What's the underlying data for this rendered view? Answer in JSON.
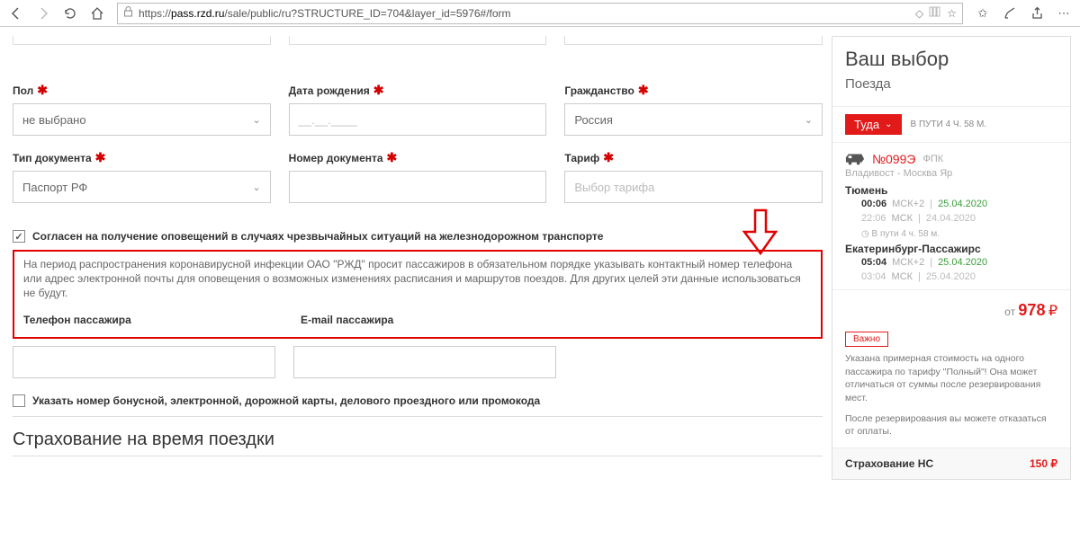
{
  "browser": {
    "url_prefix": "https://",
    "url_host": "pass.rzd.ru",
    "url_path": "/sale/public/ru?STRUCTURE_ID=704&layer_id=5976#/form"
  },
  "form": {
    "gender_label": "Пол",
    "gender_value": "не выбрано",
    "birthdate_label": "Дата рождения",
    "birthdate_placeholder": "__.__.____",
    "citizenship_label": "Гражданство",
    "citizenship_value": "Россия",
    "doctype_label": "Тип документа",
    "doctype_value": "Паспорт РФ",
    "docnum_label": "Номер документа",
    "tariff_label": "Тариф",
    "tariff_placeholder": "Выбор тарифа",
    "consent_text": "Согласен на получение оповещений в случаях чрезвычайных ситуаций на железнодорожном транспорте",
    "notice_text": "На период распространения коронавирусной инфекции ОАО \"РЖД\" просит пассажиров в обязательном порядке указывать контактный номер телефона или адрес электронной почты для оповещения о возможных изменениях расписания и маршрутов поездов. Для других целей эти данные использоваться не будут.",
    "phone_label": "Телефон пассажира",
    "email_label": "E-mail пассажира",
    "bonus_text": "Указать номер бонусной, электронной, дорожной карты, делового проездного или промокода",
    "insurance_title": "Страхование на время поездки"
  },
  "sidebar": {
    "title": "Ваш выбор",
    "subtitle": "Поезда",
    "direction": "Туда",
    "travel_label": "В ПУТИ 4 Ч. 58 М.",
    "train_number": "№099Э",
    "train_company": "ФПК",
    "route": "Владивост - Москва Яр",
    "dep_city": "Тюмень",
    "dep_time1": "00:06",
    "dep_tz1": "МСК+2",
    "dep_date1": "25.04.2020",
    "dep_time2": "22:06",
    "dep_tz2": "МСК",
    "dep_date2": "24.04.2020",
    "between": "В пути  4 ч.  58 м.",
    "arr_city": "Екатеринбург-Пассажирс",
    "arr_time1": "05:04",
    "arr_tz1": "МСК+2",
    "arr_date1": "25.04.2020",
    "arr_time2": "03:04",
    "arr_tz2": "МСК",
    "arr_date2": "25.04.2020",
    "from_label": "от",
    "price": "978",
    "currency": "₽",
    "important": "Важно",
    "important_text1": "Указана примерная стоимость на одного пассажира по тарифу \"Полный\"! Она может отличаться от суммы после резервирования мест.",
    "important_text2": "После резервирования вы можете отказаться от оплаты.",
    "insurance_label": "Страхование НС",
    "insurance_price": "150 ₽"
  }
}
